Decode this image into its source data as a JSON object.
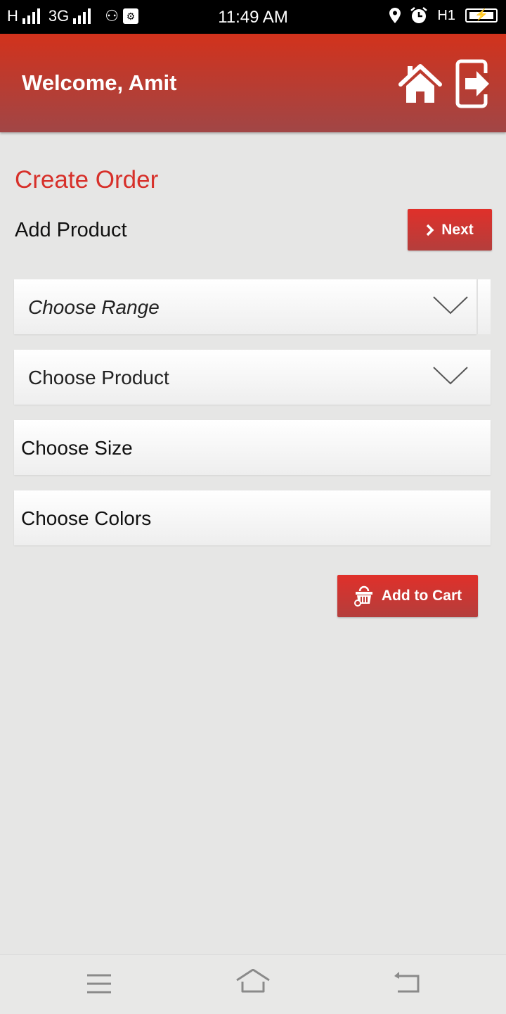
{
  "status_bar": {
    "network_1": "H",
    "network_2": "3G",
    "time": "11:49 AM",
    "hd_indicator": "H1",
    "battery_icon": "battery-charging-icon",
    "icons": [
      "signal-icon",
      "signal-icon",
      "usb-icon",
      "usb-debug-icon",
      "location-icon",
      "alarm-icon",
      "battery-charging-icon"
    ]
  },
  "app_bar": {
    "welcome": "Welcome, Amit",
    "home_icon": "home-icon",
    "logout_icon": "logout-icon",
    "background_top": "#d2321c",
    "background_bottom": "#a14646"
  },
  "page": {
    "title": "Create Order",
    "subtitle": "Add Product",
    "next_label": "Next",
    "accent": "#d7302a"
  },
  "form": {
    "range": {
      "placeholder": "Choose Range"
    },
    "product": {
      "placeholder": "Choose Product"
    },
    "size": {
      "placeholder": "Choose Size"
    },
    "colors": {
      "placeholder": "Choose Colors"
    }
  },
  "actions": {
    "add_to_cart_label": "Add to Cart"
  },
  "nav_bar": {
    "items": [
      "menu-icon",
      "home-icon",
      "back-icon"
    ]
  }
}
